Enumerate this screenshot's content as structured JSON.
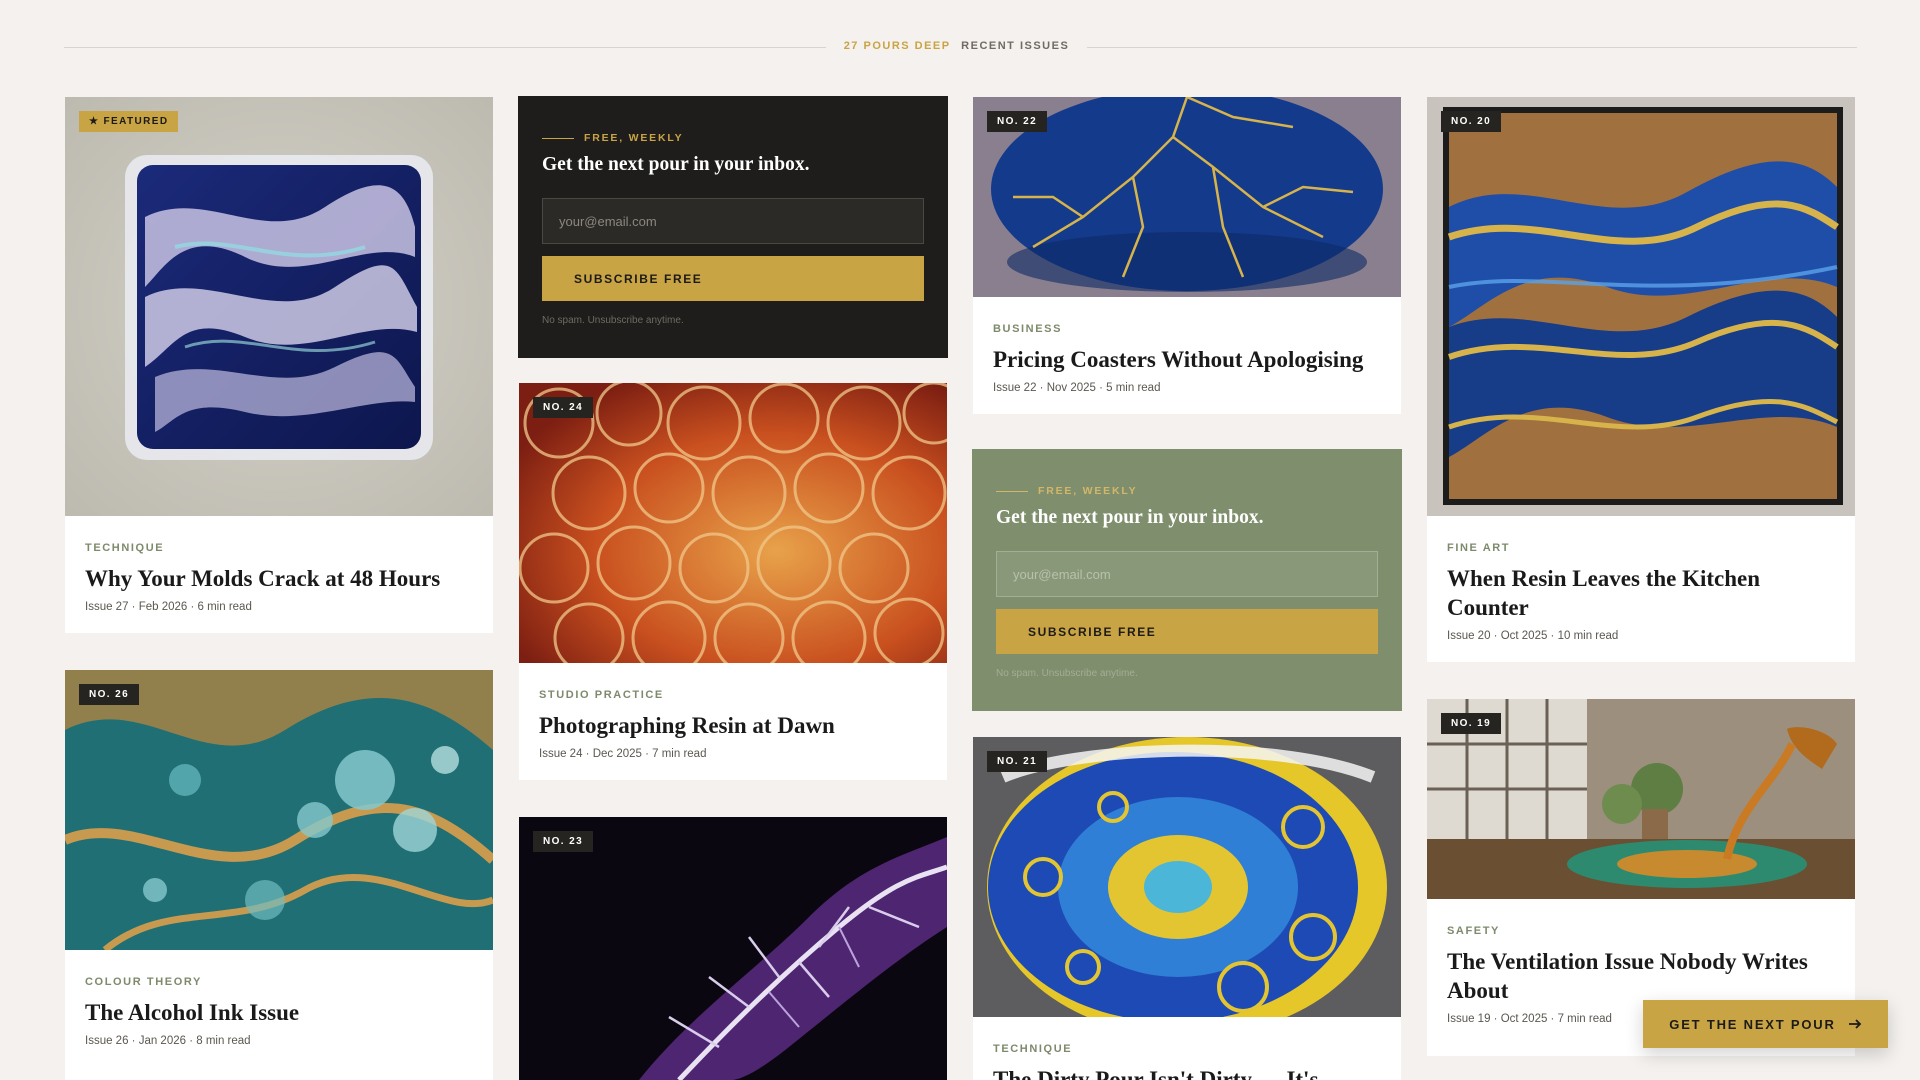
{
  "header": {
    "kicker": "27 POURS DEEP",
    "label": "RECENT ISSUES"
  },
  "colors": {
    "accent_gold": "#c9a445",
    "dark_panel": "#1e1d1b",
    "sage_panel": "#7f8e6c",
    "category_green": "#7d8a6b",
    "page_background": "#f4f1ee"
  },
  "signup": {
    "eyebrow": "FREE, WEEKLY",
    "heading": "Get the next pour in your inbox.",
    "email_placeholder": "your@email.com",
    "button_label": "SUBSCRIBE FREE",
    "note": "No spam. Unsubscribe anytime."
  },
  "cards": {
    "featured": {
      "badge": "★ FEATURED",
      "category": "TECHNIQUE",
      "title": "Why Your Molds Crack at 48 Hours",
      "meta": "Issue 27 · Feb 2026 · 6 min read"
    },
    "no26": {
      "badge": "NO. 26",
      "category": "COLOUR THEORY",
      "title": "The Alcohol Ink Issue",
      "meta": "Issue 26 · Jan 2026 · 8 min read"
    },
    "no24": {
      "badge": "NO. 24",
      "category": "STUDIO PRACTICE",
      "title": "Photographing Resin at Dawn",
      "meta": "Issue 24 · Dec 2025 · 7 min read"
    },
    "no23": {
      "badge": "NO. 23"
    },
    "no22": {
      "badge": "NO. 22",
      "category": "BUSINESS",
      "title": "Pricing Coasters Without Apologising",
      "meta": "Issue 22 · Nov 2025 · 5 min read"
    },
    "no21": {
      "badge": "NO. 21",
      "category": "TECHNIQUE",
      "title": "The Dirty Pour Isn't Dirty — It's"
    },
    "no20": {
      "badge": "NO. 20",
      "category": "FINE ART",
      "title": "When Resin Leaves the Kitchen Counter",
      "meta": "Issue 20 · Oct 2025 · 10 min read"
    },
    "no19": {
      "badge": "NO. 19",
      "category": "SAFETY",
      "title": "The Ventilation Issue Nobody Writes About",
      "meta": "Issue 19 · Oct 2025 · 7 min read"
    }
  },
  "cta": {
    "label": "GET THE NEXT POUR",
    "icon": "arrow-right-icon"
  }
}
